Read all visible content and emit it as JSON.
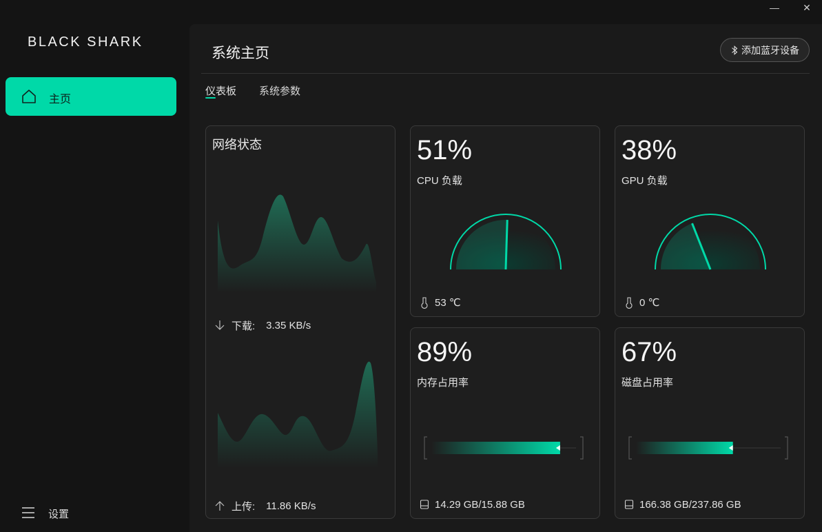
{
  "window": {
    "minimize_glyph": "—",
    "close_glyph": "✕"
  },
  "brand": {
    "logo_text": "BLACK SHARK"
  },
  "sidebar": {
    "home": {
      "label": "主页",
      "icon": "home-icon"
    },
    "settings": {
      "label": "设置",
      "icon": "menu-icon"
    }
  },
  "header": {
    "title": "系统主页",
    "bluetooth_button": "添加蓝牙设备"
  },
  "tabs": [
    {
      "label": "仪表板",
      "active": true
    },
    {
      "label": "系统参数",
      "active": false
    }
  ],
  "network": {
    "title": "网络状态",
    "download_label": "下载:",
    "download_value": "3.35 KB/s",
    "upload_label": "上传:",
    "upload_value": "11.86 KB/s"
  },
  "cpu": {
    "percent_text": "51%",
    "percent": 51,
    "label": "CPU 负载",
    "temp": "53 ℃"
  },
  "gpu": {
    "percent_text": "38%",
    "percent": 38,
    "label": "GPU 负载",
    "temp": "0 ℃"
  },
  "memory": {
    "percent_text": "89%",
    "percent": 89,
    "label": "内存占用率",
    "usage": "14.29 GB/15.88 GB"
  },
  "disk": {
    "percent_text": "67%",
    "percent": 67,
    "label": "磁盘占用率",
    "usage": "166.38 GB/237.86 GB"
  },
  "colors": {
    "accent": "#00d9a8",
    "background": "#141414",
    "panel": "#1a1a1a",
    "card": "#1e1e1e"
  }
}
